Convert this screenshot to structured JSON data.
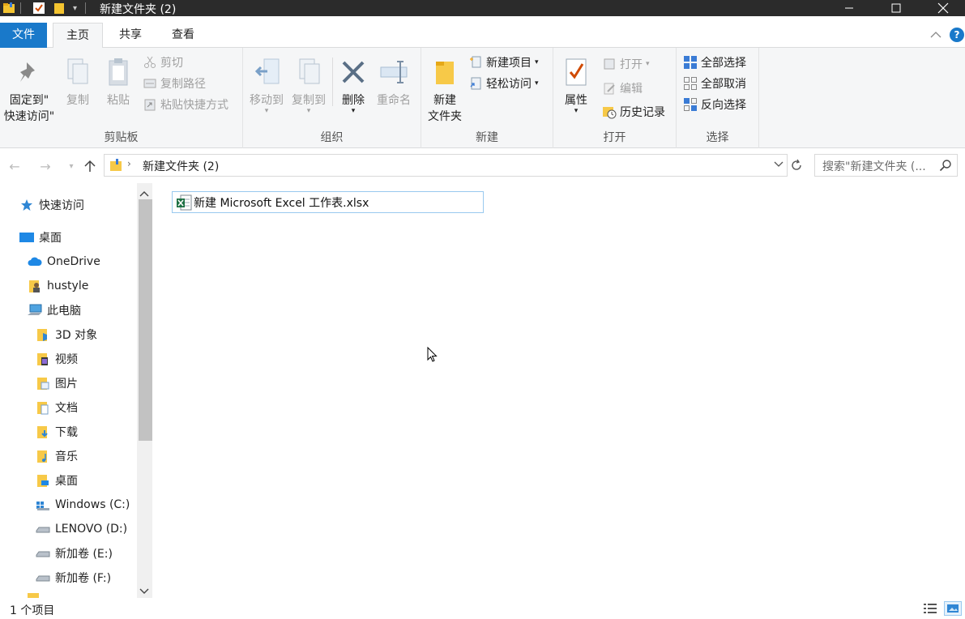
{
  "window": {
    "title": "新建文件夹 (2)"
  },
  "ribbon_tabs": [
    {
      "label": "文件"
    },
    {
      "label": "主页"
    },
    {
      "label": "共享"
    },
    {
      "label": "查看"
    }
  ],
  "clipboard": {
    "pin_label_1": "固定到\"",
    "pin_label_2": "快速访问\"",
    "copy": "复制",
    "paste": "粘贴",
    "cut": "剪切",
    "copy_path": "复制路径",
    "paste_shortcut": "粘贴快捷方式",
    "group": "剪贴板"
  },
  "organize": {
    "move_to": "移动到",
    "copy_to": "复制到",
    "delete": "删除",
    "rename": "重命名",
    "group": "组织"
  },
  "new": {
    "new_folder_1": "新建",
    "new_folder_2": "文件夹",
    "new_item": "新建项目",
    "easy_access": "轻松访问",
    "group": "新建"
  },
  "open": {
    "properties": "属性",
    "open": "打开",
    "edit": "编辑",
    "history": "历史记录",
    "group": "打开"
  },
  "select": {
    "select_all": "全部选择",
    "select_none": "全部取消",
    "invert": "反向选择",
    "group": "选择"
  },
  "address": {
    "path": "新建文件夹 (2)",
    "search_placeholder": "搜索\"新建文件夹 (..."
  },
  "nav": {
    "quick_access": "快速访问",
    "desktop": "桌面",
    "onedrive": "OneDrive",
    "user": "hustyle",
    "this_pc": "此电脑",
    "objects3d": "3D 对象",
    "videos": "视频",
    "pictures": "图片",
    "documents": "文档",
    "downloads": "下载",
    "music": "音乐",
    "desktop2": "桌面",
    "drive_c": "Windows (C:)",
    "drive_d": "LENOVO (D:)",
    "drive_e": "新加卷 (E:)",
    "drive_f": "新加卷 (F:)"
  },
  "files": [
    {
      "name": "新建 Microsoft Excel 工作表.xlsx"
    }
  ],
  "status": {
    "item_count": "1 个项目"
  },
  "colors": {
    "accent": "#1979ca",
    "titlebar": "#2b2b2b",
    "excel": "#1e7145"
  }
}
